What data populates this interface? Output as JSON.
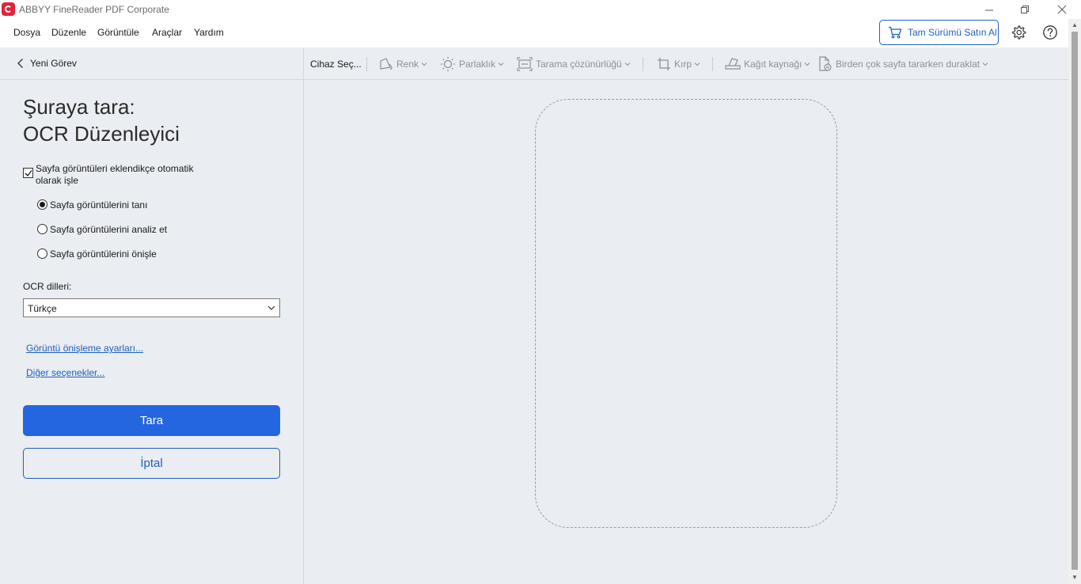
{
  "window": {
    "title": "ABBYY FineReader PDF Corporate",
    "controls": {
      "minimize": "—",
      "maximize": "❐",
      "close": "✕"
    }
  },
  "menu": {
    "items": [
      "Dosya",
      "Düzenle",
      "Görüntüle",
      "Araçlar",
      "Yardım"
    ],
    "buy_label": "Tam Sürümü Satın Al"
  },
  "left_panel": {
    "back_label": "Yeni Görev",
    "heading_line1": "Şuraya tara:",
    "heading_line2": "OCR Düzenleyici",
    "auto_process": {
      "label": "Sayfa görüntüleri eklendikçe otomatik olarak işle",
      "checked": true
    },
    "radios": [
      {
        "label": "Sayfa görüntülerini tanı",
        "selected": true
      },
      {
        "label": "Sayfa görüntülerini analiz et",
        "selected": false
      },
      {
        "label": "Sayfa görüntülerini önişle",
        "selected": false
      }
    ],
    "ocr_label": "OCR dilleri:",
    "ocr_value": "Türkçe",
    "links": {
      "preprocess": "Görüntü önişleme ayarları...",
      "more": "Diğer seçenekler..."
    },
    "scan_button": "Tara",
    "cancel_button": "İptal"
  },
  "toolbar": {
    "device": "Cihaz Seç...",
    "color": "Renk",
    "brightness": "Parlaklık",
    "resolution": "Tarama çözünürlüğü",
    "crop": "Kırp",
    "paper_source": "Kağıt kaynağı",
    "pause": "Birden çok sayfa tararken duraklat"
  },
  "colors": {
    "accent": "#2466e0",
    "link": "#1f5fbf",
    "panel_bg": "#eaedf1",
    "logo": "#e2233b"
  }
}
